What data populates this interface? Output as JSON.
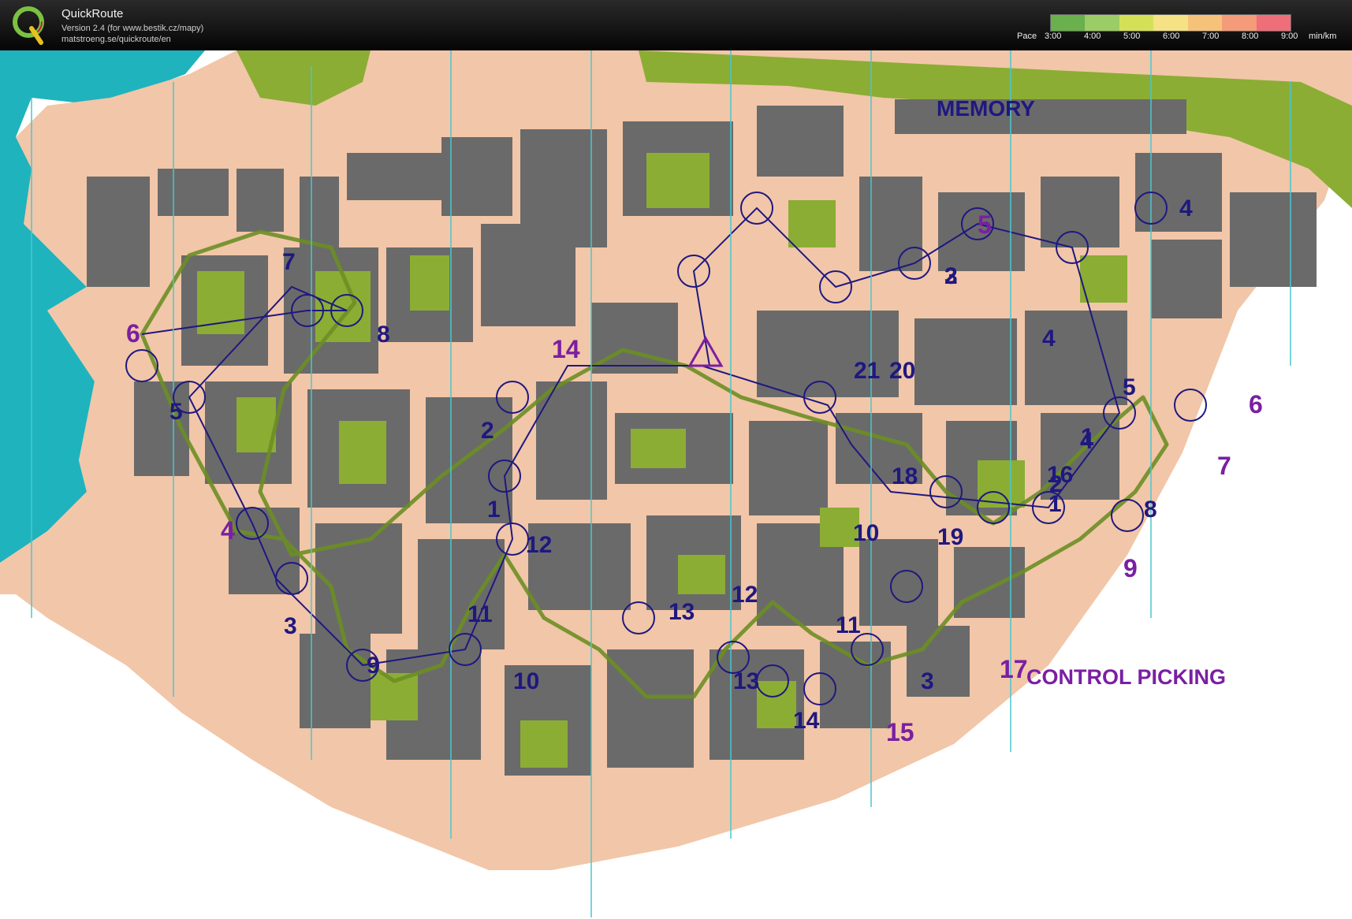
{
  "app": {
    "title": "QuickRoute",
    "version": "Version 2.4  (for www.bestik.cz/mapy)",
    "url": "matstroeng.se/quickroute/en",
    "logo_letter": "Q"
  },
  "pace_legend": {
    "pace_label": "Pace",
    "ticks": [
      "3:00",
      "4:00",
      "5:00",
      "6:00",
      "7:00",
      "8:00",
      "9:00"
    ],
    "unit": "min/km",
    "colors": [
      "#6ab04c",
      "#9ccc65",
      "#d4e157",
      "#f4e285",
      "#f6c27a",
      "#f49b7a",
      "#ee6e7a"
    ]
  },
  "map": {
    "colors": {
      "water": "#1fb3be",
      "paved": "#f2c6a8",
      "building": "#6a6a6a",
      "green": "#8bad34",
      "vegetation_light": "#d6e39a",
      "route": "#6b8e23",
      "course": "#7a1fa2",
      "course_dark": "#1f1880",
      "magnetic_north": "#48c7cf"
    },
    "text_labels": {
      "memory": "MEMORY",
      "control_picking": "CONTROL PICKING"
    },
    "purple_controls": [
      "6",
      "14",
      "4",
      "5",
      "6",
      "7",
      "9",
      "15",
      "17"
    ],
    "dark_controls": [
      "7",
      "8",
      "5",
      "4",
      "3",
      "9",
      "2",
      "1",
      "12",
      "11",
      "10",
      "13",
      "12",
      "13",
      "14",
      "11",
      "10",
      "19",
      "18",
      "20",
      "21",
      "2",
      "1",
      "16",
      "3",
      "4",
      "1",
      "2",
      "3",
      "5",
      "4",
      "8"
    ]
  }
}
